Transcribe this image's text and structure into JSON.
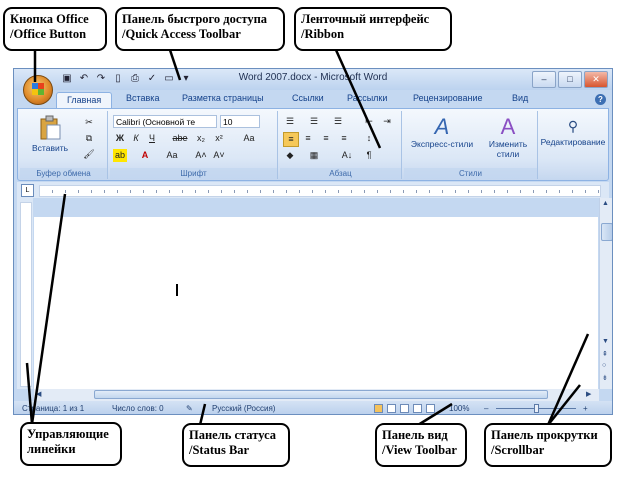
{
  "callouts": {
    "office_button": [
      "Кнопка Office",
      "/Office Button"
    ],
    "quick_access": [
      "Панель быстрого доступа",
      "/Quick Access Toolbar"
    ],
    "ribbon": [
      "Ленточный интерфейс",
      "/Ribbon"
    ],
    "rulers": [
      "Управляющие",
      "линейки"
    ],
    "status_bar": [
      "Панель статуса",
      "/Status Bar"
    ],
    "view_toolbar": [
      "Панель вид",
      "/View Toolbar"
    ],
    "scrollbar": [
      "Панель прокрутки",
      "/Scrollbar"
    ]
  },
  "window": {
    "title": "Word 2007.docx - Microsoft Word",
    "controls": {
      "minimize": "–",
      "maximize": "□",
      "close": "✕"
    }
  },
  "qat_icons": [
    "save-icon",
    "undo-icon",
    "redo-icon",
    "new-doc-icon",
    "print-icon",
    "spell-icon",
    "open-icon",
    "qat-dropdown-icon"
  ],
  "tabs": [
    "Главная",
    "Вставка",
    "Разметка страницы",
    "Ссылки",
    "Рассылки",
    "Рецензирование",
    "Вид"
  ],
  "ribbon": {
    "clipboard": {
      "label": "Буфер обмена",
      "paste": "Вставить"
    },
    "font": {
      "label": "Шрифт",
      "font_name": "Calibri (Основной те",
      "font_size": "10",
      "bold": "Ж",
      "italic": "К",
      "underline": "Ч",
      "strike": "abe",
      "subscript": "x₂",
      "superscript": "x²",
      "clear": "Aa",
      "grow": "A˄",
      "shrink": "A˅",
      "case": "Aa"
    },
    "paragraph": {
      "label": "Абзац",
      "show_marks": "¶",
      "sort": "A↓"
    },
    "styles": {
      "label": "Стили",
      "express": "Экспресс-стили",
      "change_line1": "Изменить",
      "change_line2": "стили"
    },
    "editing": {
      "label": "Редактирование"
    }
  },
  "status": {
    "page": "Страница: 1 из 1",
    "words": "Число слов: 0",
    "language": "Русский (Россия)",
    "zoom": "100%",
    "zoom_minus": "–",
    "zoom_plus": "+"
  },
  "colors": {
    "accent": "#15428b",
    "ribbon_bg": "#dbe7f6",
    "frame": "#c4d8f1"
  }
}
